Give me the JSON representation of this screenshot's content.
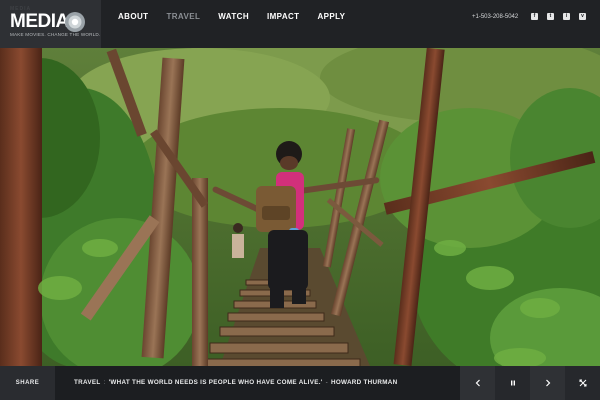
{
  "brand": {
    "top_text": "MEDIA",
    "wordmark": "MEDIA",
    "tagline": "MAKE MOVIES. CHANGE THE WORLD."
  },
  "nav": {
    "items": [
      {
        "label": "ABOUT"
      },
      {
        "label": "TRAVEL"
      },
      {
        "label": "WATCH"
      },
      {
        "label": "IMPACT"
      },
      {
        "label": "APPLY"
      }
    ],
    "active": "TRAVEL"
  },
  "header": {
    "phone": "+1-503-208-5042",
    "social_icons": [
      "facebook-icon",
      "twitter-icon",
      "instagram-icon",
      "vimeo-icon"
    ],
    "social_glyphs": [
      "f",
      "t",
      "i",
      "v"
    ]
  },
  "footer": {
    "share_label": "SHARE",
    "category": "TRAVEL",
    "quote": "'WHAT THE WORLD NEEDS IS PEOPLE WHO HAVE COME ALIVE.'",
    "author": "HOWARD THURMAN",
    "controls": [
      "previous-icon",
      "pause-icon",
      "next-icon",
      "fullscreen-icon"
    ]
  },
  "colors": {
    "nav_background": "#202225",
    "logo_background": "#2e3034",
    "active_nav": "#8b8f94",
    "text": "#ffffff"
  }
}
